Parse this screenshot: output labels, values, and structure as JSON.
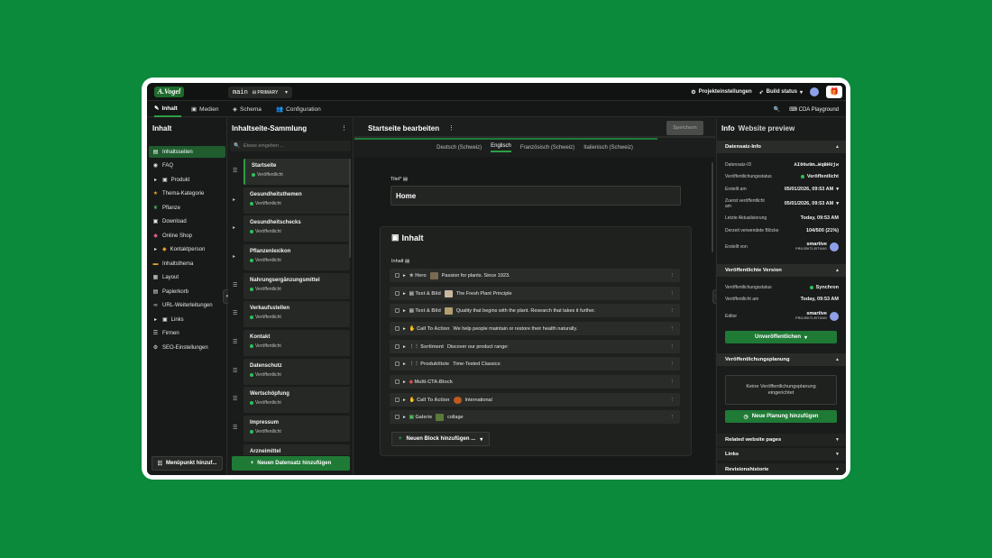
{
  "topbar": {
    "logo": "A.Vogel",
    "branch": "main",
    "branch_tag": "PRIMARY",
    "project_settings": "Projekteinstellungen",
    "build_status": "Build status"
  },
  "nav": {
    "tabs": [
      {
        "label": "Inhalt"
      },
      {
        "label": "Medien"
      },
      {
        "label": "Schema"
      },
      {
        "label": "Configuration"
      }
    ],
    "cda_playground": "CDA Playground"
  },
  "sidebar": {
    "title": "Inhalt",
    "items": [
      {
        "label": "Inhaltsseiten"
      },
      {
        "label": "FAQ"
      },
      {
        "label": "Produkt"
      },
      {
        "label": "Thema-Kategorie"
      },
      {
        "label": "Pflanze"
      },
      {
        "label": "Download"
      },
      {
        "label": "Online Shop"
      },
      {
        "label": "Kontaktperson"
      },
      {
        "label": "Inhaltsthema"
      },
      {
        "label": "Layout"
      },
      {
        "label": "Papierkorb"
      },
      {
        "label": "URL-Weiterleitungen"
      },
      {
        "label": "Links"
      },
      {
        "label": "Firmen"
      },
      {
        "label": "SEO-Einstellungen"
      }
    ],
    "add_menu_item": "Menüpunkt hinzuf..."
  },
  "collection": {
    "title": "Inhaltseite-Sammlung",
    "search_placeholder": "Etwas eingeben ...",
    "published": "Veröffentlicht",
    "entries": [
      {
        "title": "Startseite"
      },
      {
        "title": "Gesundheitsthemen"
      },
      {
        "title": "Gesundheitschecks"
      },
      {
        "title": "Pflanzenlexikon"
      },
      {
        "title": "Nahrungsergänzungsmittel"
      },
      {
        "title": "Verkaufsstellen"
      },
      {
        "title": "Kontakt"
      },
      {
        "title": "Datenschutz"
      },
      {
        "title": "Wertschöpfung"
      },
      {
        "title": "Impressum"
      },
      {
        "title": "Arzneimittel"
      }
    ],
    "add_entry": "Neuen Datensatz hinzufügen"
  },
  "editor": {
    "title": "Startseite bearbeiten",
    "save": "Speichern",
    "progress": 0.84,
    "languages": [
      {
        "label": "Deutsch (Schweiz)"
      },
      {
        "label": "Englisch"
      },
      {
        "label": "Französisch (Schweiz)"
      },
      {
        "label": "Italienisch (Schweiz)"
      }
    ],
    "title_field_label": "Titel*",
    "title_value": "Home",
    "content_heading": "Inhalt",
    "content_field_label": "Inhalt",
    "blocks": [
      {
        "type": "Hero",
        "text": "Passion for plants. Since 1923."
      },
      {
        "type": "Text & Bild",
        "text": "The Fresh Plant Principle"
      },
      {
        "type": "Text & Bild",
        "text": "Quality that begins with the plant. Research that takes it further."
      },
      {
        "type": "Call To Action",
        "text": "We help people maintain or restore their health naturally."
      },
      {
        "type": "Sortiment",
        "text": "Discover our product range:"
      },
      {
        "type": "Produktliste",
        "text": "Time-Tested Classics:"
      },
      {
        "type": "Multi-CTA-Block",
        "text": ""
      },
      {
        "type": "Call To Action",
        "text": "International"
      },
      {
        "type": "Galerie",
        "text": "collage"
      }
    ],
    "add_block": "Neuen Block hinzufügen ..."
  },
  "info": {
    "tab_info": "Info",
    "tab_preview": "Website preview",
    "record_info": {
      "heading": "Datensatz-Info",
      "rows": [
        {
          "label": "Datensatz-ID",
          "value": "AI86w9m…WqBHUjw"
        },
        {
          "label": "Veröffentlichungsstatus",
          "value": "Veröffentlicht"
        },
        {
          "label": "Erstellt am",
          "value": "05/01/2026, 09:53 AM"
        },
        {
          "label": "Zuerst veröffentlicht am",
          "value": "05/01/2026, 09:53 AM"
        },
        {
          "label": "Letzte Aktualisierung",
          "value": "Today, 09:53 AM"
        },
        {
          "label": "Derzeit verwendete Blöcke",
          "value": "104/500 (21%)"
        }
      ],
      "created_by_label": "Erstellt von",
      "created_by_name": "smartive",
      "created_by_company": "PROJEKTLEITUNG"
    },
    "published_version": {
      "heading": "Veröffentlichte Version",
      "status_label": "Veröffentlichungsstatus",
      "status_value": "Synchron",
      "published_label": "Veröffentlicht am",
      "published_value": "Today, 09:53 AM",
      "editor_label": "Editor",
      "editor_name": "smartive",
      "editor_company": "PROJEKTLEITUNG",
      "unpublish": "Unveröffentlichen"
    },
    "schedule": {
      "heading": "Veröffentlichungsplanung",
      "empty": "Keine Veröffentlichungsplanung eingerichtet",
      "add": "Neue Planung hinzufügen"
    },
    "more_sections": [
      {
        "label": "Related website pages"
      },
      {
        "label": "Links"
      },
      {
        "label": "Revisionshistorie"
      }
    ]
  }
}
